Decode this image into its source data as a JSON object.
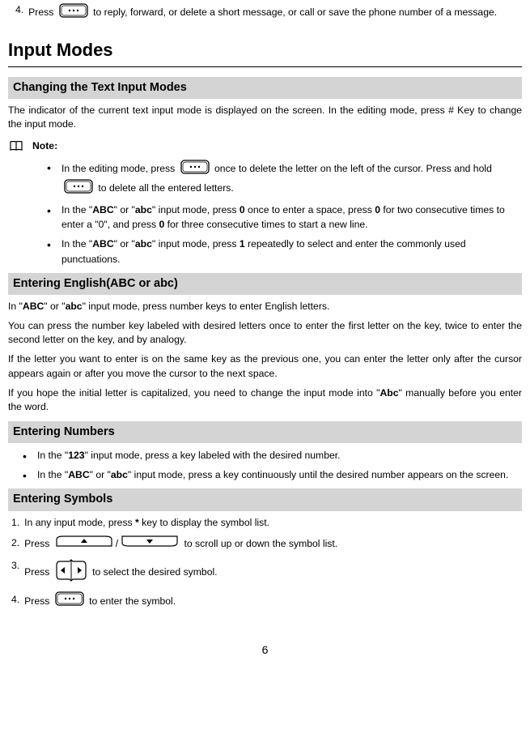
{
  "step4": {
    "num": "4.",
    "prefix": "Press ",
    "suffix": " to reply, forward, or delete a short message, or call or save the phone number of a message."
  },
  "h1": "Input Modes",
  "section1": {
    "title": "Changing the Text Input Modes",
    "para": "The indicator of the current text input mode is displayed on the screen. In the editing mode, press # Key to change the input mode.",
    "note_label": "Note:",
    "b1_a": "In the editing mode, press ",
    "b1_b": " once to delete the letter on the left of the cursor. Press and hold ",
    "b1_c": " to delete all the entered letters.",
    "b2_a": "In the \"",
    "b2_abc1": "ABC",
    "b2_b": "\" or \"",
    "b2_abc2": "abc",
    "b2_c": "\" input mode, press ",
    "b2_zero1": "0",
    "b2_d": " once to enter a space, press ",
    "b2_zero2": "0",
    "b2_e": " for two consecutive times to enter a \"0\", and press ",
    "b2_zero3": "0",
    "b2_f": " for three consecutive times to start a new line.",
    "b3_a": "In the \"",
    "b3_abc1": "ABC",
    "b3_b": "\" or \"",
    "b3_abc2": "abc",
    "b3_c": "\" input mode, press ",
    "b3_one": "1",
    "b3_d": " repeatedly to select and enter the commonly used punctuations."
  },
  "section2": {
    "title": "Entering English(ABC or abc)",
    "p1_a": "In \"",
    "p1_abc1": "ABC",
    "p1_b": "\" or \"",
    "p1_abc2": "abc",
    "p1_c": "\" input mode, press number keys to enter English letters.",
    "p2": "You can press the number key labeled with desired letters once to enter the first letter on the key, twice to enter the second letter on the key, and by analogy.",
    "p3": "If the letter you want to enter is on the same key as the previous one, you can enter the letter only after the cursor appears again or after you move the cursor to the next space.",
    "p4_a": "If you hope the initial letter is capitalized, you need to change the input mode into \"",
    "p4_abc": "Abc",
    "p4_b": "\" manually before you enter the word."
  },
  "section3": {
    "title": "Entering Numbers",
    "b1_a": "In the \"",
    "b1_123": "123",
    "b1_b": "\" input mode, press a key labeled with the desired number.",
    "b2_a": "In the \"",
    "b2_abc1": "ABC",
    "b2_b": "\" or \"",
    "b2_abc2": "abc",
    "b2_c": "\" input mode, press a key continuously until the desired number appears on the screen."
  },
  "section4": {
    "title": "Entering Symbols",
    "l1_n": "1.",
    "l1_a": "In any input mode, press ",
    "l1_star": "*",
    "l1_b": " key to display the symbol list.",
    "l2_n": "2.",
    "l2_a": "Press ",
    "l2_slash": "/",
    "l2_b": " to scroll up or down the symbol list.",
    "l3_n": "3.",
    "l3_a": "Press ",
    "l3_b": " to select the desired symbol.",
    "l4_n": "4.",
    "l4_a": "Press ",
    "l4_b": " to enter the symbol."
  },
  "page_number": "6"
}
